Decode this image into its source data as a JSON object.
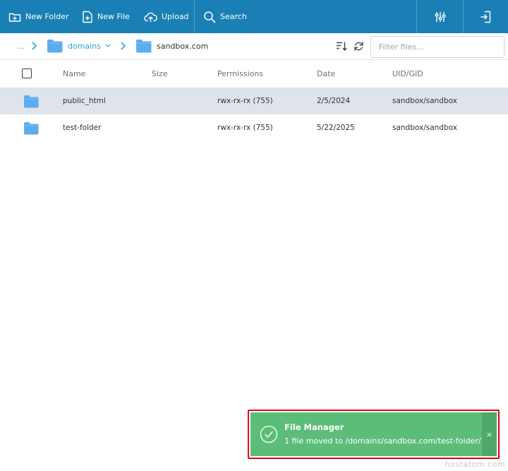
{
  "toolbar": {
    "new_folder": "New Folder",
    "new_file": "New File",
    "upload": "Upload",
    "search": "Search"
  },
  "breadcrumb": {
    "ellipsis": "...",
    "domains": "domains",
    "current": "sandbox.com"
  },
  "filter": {
    "placeholder": "Filter files..."
  },
  "table": {
    "headers": {
      "name": "Name",
      "size": "Size",
      "permissions": "Permissions",
      "date": "Date",
      "uid": "UID/GID"
    },
    "rows": [
      {
        "name": "public_html",
        "size": "",
        "permissions": "rwx-rx-rx (755)",
        "date": "2/5/2024",
        "uid": "sandbox/sandbox",
        "selected": true
      },
      {
        "name": "test-folder",
        "size": "",
        "permissions": "rwx-rx-rx (755)",
        "date": "5/22/2025",
        "uid": "sandbox/sandbox",
        "selected": false
      }
    ]
  },
  "toast": {
    "title": "File Manager",
    "message": "1 file moved to /domains/sandbox.com/test-folder/",
    "close": "×"
  },
  "watermark": "hostatom.com",
  "colors": {
    "toolbar": "#1a7fb5",
    "accent": "#2aa3d8",
    "folder": "#5aaef0",
    "selected_row": "#dfe3ea",
    "toast": "#5cbd78",
    "toast_highlight": "#e2001a"
  },
  "icons": {
    "new_folder": "folder-plus-icon",
    "new_file": "file-plus-icon",
    "upload": "cloud-upload-icon",
    "search": "search-icon",
    "settings": "sliders-icon",
    "logout": "logout-icon",
    "sort": "sort-icon",
    "refresh": "refresh-icon",
    "toast": "check-circle-icon"
  }
}
